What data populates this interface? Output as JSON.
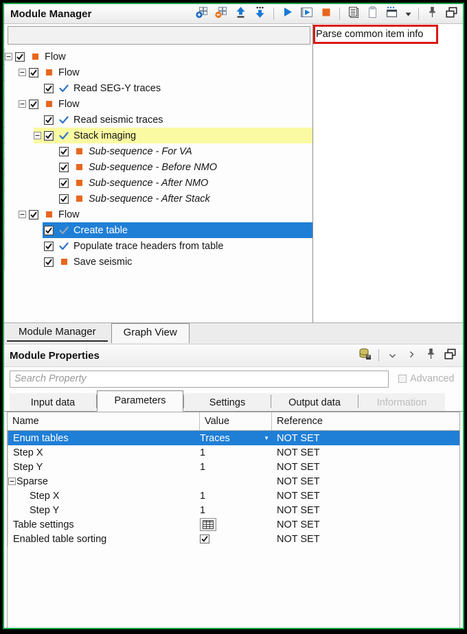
{
  "window": {
    "title": "Module Manager"
  },
  "top_toolbar": {
    "icons": [
      {
        "name": "add-module-icon"
      },
      {
        "name": "remove-module-icon"
      },
      {
        "name": "move-up-icon"
      },
      {
        "name": "move-down-icon"
      },
      {
        "name": "run-icon"
      },
      {
        "name": "run-selected-icon"
      },
      {
        "name": "stop-icon"
      },
      {
        "name": "log-list-icon"
      },
      {
        "name": "clipboard-icon"
      },
      {
        "name": "new-window-icon"
      },
      {
        "name": "dropdown-arrow-icon"
      },
      {
        "name": "pin-icon"
      },
      {
        "name": "float-window-icon"
      }
    ]
  },
  "module_tree": {
    "filter_value": "",
    "items": [
      {
        "label": "Flow",
        "level": 0,
        "expander": true,
        "checked": true,
        "icon": "module"
      },
      {
        "label": "Flow",
        "level": 1,
        "expander": true,
        "checked": true,
        "icon": "module"
      },
      {
        "label": "Read SEG-Y traces",
        "level": 2,
        "expander": false,
        "checked": true,
        "icon": "check"
      },
      {
        "label": "Flow",
        "level": 1,
        "expander": true,
        "checked": true,
        "icon": "module"
      },
      {
        "label": "Read seismic traces",
        "level": 2,
        "expander": false,
        "checked": true,
        "icon": "check"
      },
      {
        "label": "Stack imaging",
        "level": 2,
        "expander": true,
        "checked": true,
        "icon": "check",
        "highlight": true
      },
      {
        "label": "Sub-sequence - For VA",
        "level": 3,
        "expander": false,
        "checked": true,
        "icon": "module",
        "italic": true
      },
      {
        "label": "Sub-sequence - Before NMO",
        "level": 3,
        "expander": false,
        "checked": true,
        "icon": "module",
        "italic": true
      },
      {
        "label": "Sub-sequence - After NMO",
        "level": 3,
        "expander": false,
        "checked": true,
        "icon": "module",
        "italic": true
      },
      {
        "label": "Sub-sequence - After Stack",
        "level": 3,
        "expander": false,
        "checked": true,
        "icon": "module",
        "italic": true
      },
      {
        "label": "Flow",
        "level": 1,
        "expander": true,
        "checked": true,
        "icon": "module"
      },
      {
        "label": "Create table",
        "level": 2,
        "expander": false,
        "checked": true,
        "icon": "check-muted",
        "selected": true
      },
      {
        "label": "Populate trace headers from table",
        "level": 2,
        "expander": false,
        "checked": true,
        "icon": "check"
      },
      {
        "label": "Save seismic",
        "level": 2,
        "expander": false,
        "checked": true,
        "icon": "module"
      }
    ]
  },
  "right_panel": {
    "text": "Parse common item info"
  },
  "dock_tabs": [
    {
      "label": "Module Manager",
      "active": true
    },
    {
      "label": "Graph View",
      "active": false
    }
  ],
  "module_properties": {
    "title": "Module Properties",
    "toolbar_icons": [
      {
        "name": "database-save-icon"
      },
      {
        "name": "chevron-down-icon"
      },
      {
        "name": "chevron-right-icon"
      },
      {
        "name": "pin-icon"
      },
      {
        "name": "float-window-icon"
      }
    ],
    "search_placeholder": "Search Property",
    "advanced_label": "Advanced",
    "tabs": [
      {
        "label": "Input data",
        "active": false,
        "disabled": false
      },
      {
        "label": "Parameters",
        "active": true,
        "disabled": false
      },
      {
        "label": "Settings",
        "active": false,
        "disabled": false
      },
      {
        "label": "Output data",
        "active": false,
        "disabled": false
      },
      {
        "label": "Information",
        "active": false,
        "disabled": true
      }
    ],
    "grid": {
      "columns": [
        "Name",
        "Value",
        "Reference"
      ],
      "rows": [
        {
          "name": "Enum tables",
          "level": 0,
          "expander": false,
          "value": "Traces",
          "value_type": "combo",
          "reference": "NOT SET",
          "selected": true
        },
        {
          "name": "Step X",
          "level": 0,
          "expander": false,
          "value": "1",
          "value_type": "text",
          "reference": "NOT SET",
          "selected": false
        },
        {
          "name": "Step Y",
          "level": 0,
          "expander": false,
          "value": "1",
          "value_type": "text",
          "reference": "NOT SET",
          "selected": false
        },
        {
          "name": "Sparse",
          "level": 0,
          "expander": true,
          "value": "",
          "value_type": "none",
          "reference": "NOT SET",
          "selected": false
        },
        {
          "name": "Step X",
          "level": 1,
          "expander": false,
          "value": "1",
          "value_type": "text",
          "reference": "NOT SET",
          "selected": false
        },
        {
          "name": "Step Y",
          "level": 1,
          "expander": false,
          "value": "1",
          "value_type": "text",
          "reference": "NOT SET",
          "selected": false
        },
        {
          "name": "Table settings",
          "level": 0,
          "expander": false,
          "value": "",
          "value_type": "table-button",
          "reference": "NOT SET",
          "selected": false
        },
        {
          "name": "Enabled table sorting",
          "level": 0,
          "expander": false,
          "value": "checked",
          "value_type": "checkbox",
          "reference": "NOT SET",
          "selected": false
        }
      ]
    }
  },
  "colors": {
    "selection_blue": "#1f7fd6",
    "highlight_yellow": "#fafaa2",
    "module_orange": "#e8671c",
    "check_blue": "#2f74c9",
    "annotation_red": "#da1914",
    "frame_green": "#19a549"
  }
}
